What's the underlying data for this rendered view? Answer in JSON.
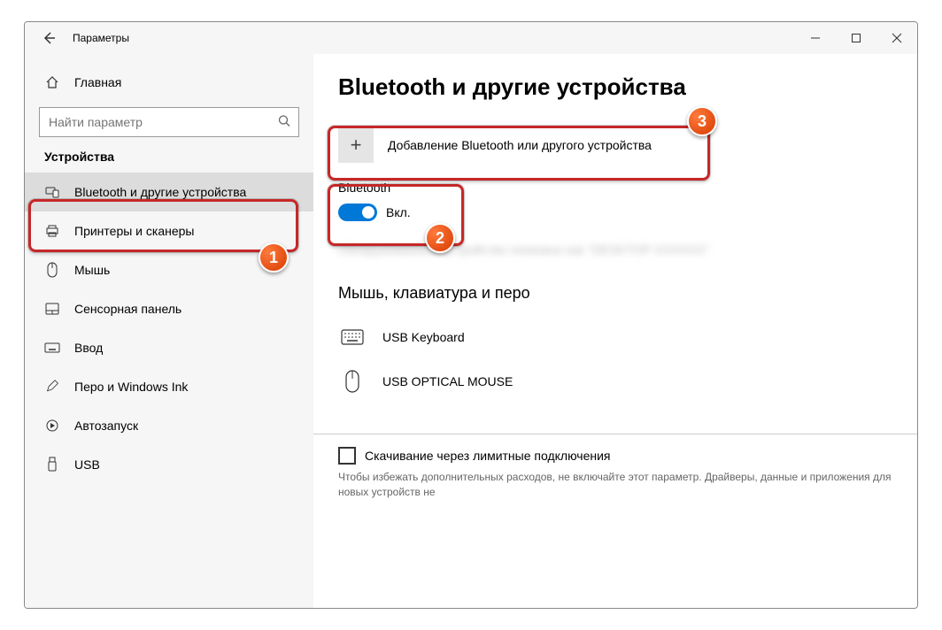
{
  "window": {
    "title": "Параметры"
  },
  "sidebar": {
    "home_label": "Главная",
    "search_placeholder": "Найти параметр",
    "category": "Устройства",
    "items": [
      {
        "label": "Bluetooth и другие устройства"
      },
      {
        "label": "Принтеры и сканеры"
      },
      {
        "label": "Мышь"
      },
      {
        "label": "Сенсорная панель"
      },
      {
        "label": "Ввод"
      },
      {
        "label": "Перо и Windows Ink"
      },
      {
        "label": "Автозапуск"
      },
      {
        "label": "USB"
      }
    ]
  },
  "main": {
    "heading": "Bluetooth и другие устройства",
    "add_device_label": "Добавление Bluetooth или другого устройства",
    "bluetooth_label": "Bluetooth",
    "toggle_state_label": "Вкл.",
    "blurred_text": "Обнаруживаемое устройство показано как \"DESKTOP-XXXXXX\"",
    "section_mouse_kb_pen": "Мышь, клавиатура и перо",
    "devices": [
      {
        "label": "USB Keyboard"
      },
      {
        "label": "USB OPTICAL MOUSE"
      }
    ],
    "download_over_metered": "Скачивание через лимитные подключения",
    "download_hint": "Чтобы избежать дополнительных расходов, не включайте этот параметр. Драйверы, данные и приложения для новых устройств не"
  },
  "annotations": {
    "badge1": "1",
    "badge2": "2",
    "badge3": "3"
  }
}
